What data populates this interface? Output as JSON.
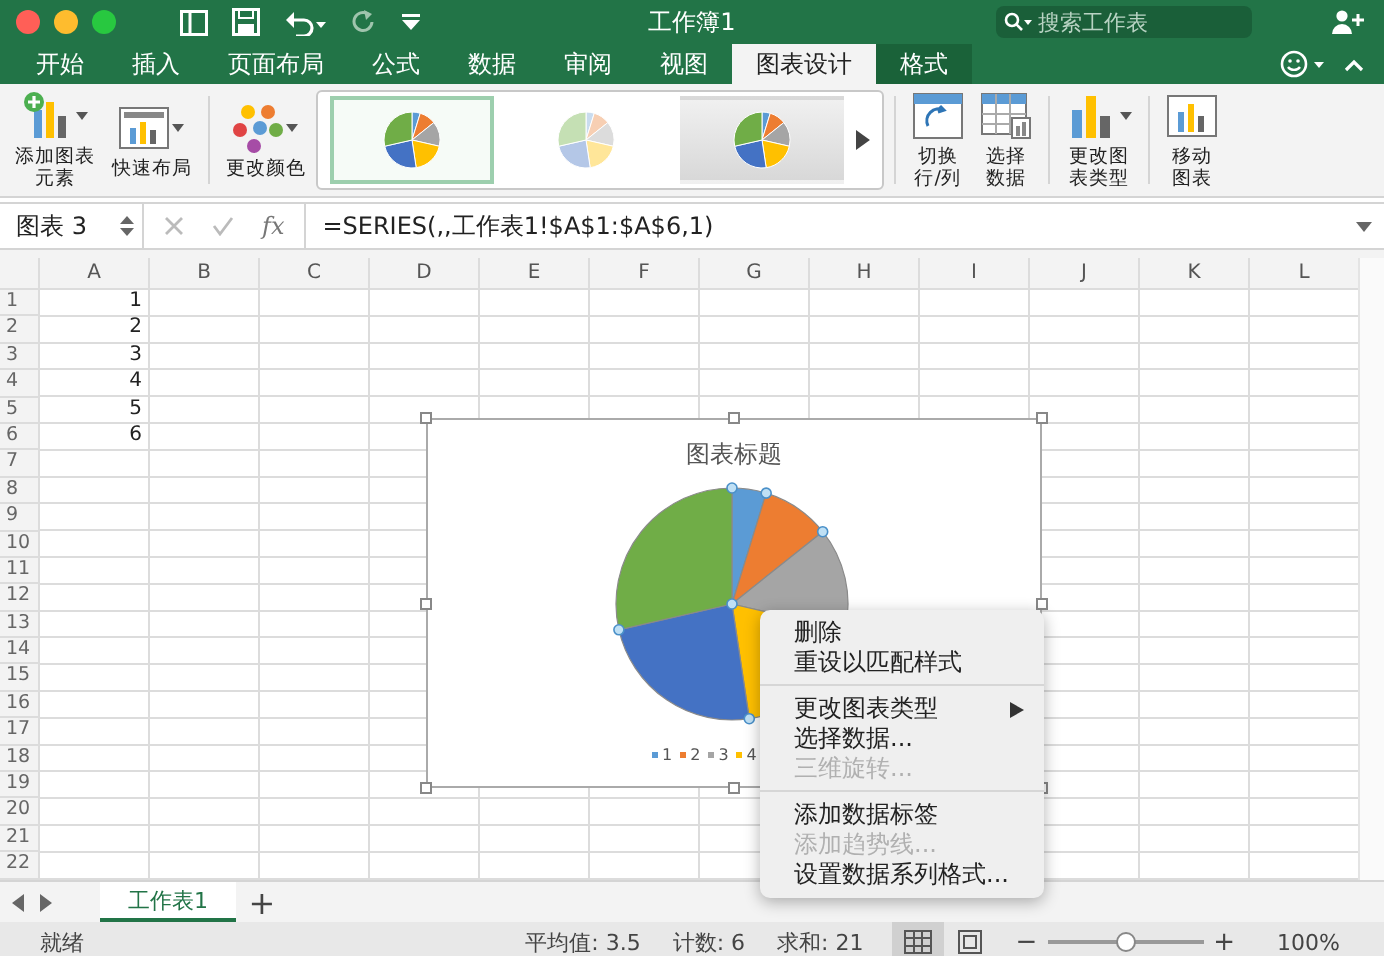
{
  "window": {
    "title": "工作簿1"
  },
  "search": {
    "placeholder": "搜索工作表"
  },
  "tabs": [
    {
      "label": "开始",
      "selected": false,
      "kind": "normal"
    },
    {
      "label": "插入",
      "selected": false,
      "kind": "normal"
    },
    {
      "label": "页面布局",
      "selected": false,
      "kind": "normal"
    },
    {
      "label": "公式",
      "selected": false,
      "kind": "normal"
    },
    {
      "label": "数据",
      "selected": false,
      "kind": "normal"
    },
    {
      "label": "审阅",
      "selected": false,
      "kind": "normal"
    },
    {
      "label": "视图",
      "selected": false,
      "kind": "normal"
    },
    {
      "label": "图表设计",
      "selected": true,
      "kind": "contextual"
    },
    {
      "label": "格式",
      "selected": false,
      "kind": "contextual"
    }
  ],
  "ribbon": {
    "left": [
      {
        "label": "添加图表元素",
        "kind": "add-element",
        "caret": true
      },
      {
        "label": "快速布局",
        "kind": "quick-layout",
        "caret": true
      },
      {
        "label": "更改颜色",
        "kind": "colors",
        "caret": true
      }
    ],
    "gallery": [
      {
        "kind": "colorful",
        "selected": true
      },
      {
        "kind": "pastel",
        "selected": false
      },
      {
        "kind": "shaded",
        "selected": false
      }
    ],
    "right": [
      {
        "label": "切换行/列",
        "kind": "switch",
        "caret": false
      },
      {
        "label": "选择数据",
        "kind": "select-data",
        "caret": false
      },
      {
        "label": "更改图表类型",
        "kind": "change-type",
        "caret": true
      },
      {
        "label": "移动图表",
        "kind": "move",
        "caret": false
      }
    ]
  },
  "formula_bar": {
    "name_box": "图表 3",
    "fx": "fx",
    "formula": "=SERIES(,,工作表1!$A$1:$A$6,1)"
  },
  "columns": [
    "A",
    "B",
    "C",
    "D",
    "E",
    "F",
    "G",
    "H",
    "I",
    "J",
    "K",
    "L"
  ],
  "rows": [
    {
      "label": "1",
      "values": [
        "1"
      ]
    },
    {
      "label": "2",
      "values": [
        "2"
      ]
    },
    {
      "label": "3",
      "values": [
        "3"
      ]
    },
    {
      "label": "4",
      "values": [
        "4"
      ]
    },
    {
      "label": "5",
      "values": [
        "5"
      ]
    },
    {
      "label": "6",
      "values": [
        "6"
      ]
    },
    {
      "label": "7"
    },
    {
      "label": "8"
    },
    {
      "label": "9"
    },
    {
      "label": "10"
    },
    {
      "label": "11"
    },
    {
      "label": "12"
    },
    {
      "label": "13"
    },
    {
      "label": "14"
    },
    {
      "label": "15"
    },
    {
      "label": "16"
    },
    {
      "label": "17"
    },
    {
      "label": "18"
    },
    {
      "label": "19"
    },
    {
      "label": "20"
    },
    {
      "label": "21"
    },
    {
      "label": "22"
    }
  ],
  "chart": {
    "title": "图表标题",
    "legend": [
      "1",
      "2",
      "3",
      "4"
    ]
  },
  "context_menu": {
    "groups": [
      [
        {
          "label": "删除",
          "disabled": false,
          "submenu": false
        },
        {
          "label": "重设以匹配样式",
          "disabled": false,
          "submenu": false
        }
      ],
      [
        {
          "label": "更改图表类型",
          "disabled": false,
          "submenu": true
        },
        {
          "label": "选择数据...",
          "disabled": false,
          "submenu": false
        },
        {
          "label": "三维旋转...",
          "disabled": true,
          "submenu": false
        }
      ],
      [
        {
          "label": "添加数据标签",
          "disabled": false,
          "submenu": false
        },
        {
          "label": "添加趋势线...",
          "disabled": true,
          "submenu": false
        },
        {
          "label": "设置数据系列格式...",
          "disabled": false,
          "submenu": false
        }
      ]
    ]
  },
  "sheet_tabs": [
    {
      "label": "工作表1",
      "selected": true
    }
  ],
  "add_sheet": "+",
  "status_bar": {
    "ready": "就绪",
    "stats": [
      "平均值: 3.5",
      "计数: 6",
      "求和: 21"
    ],
    "views": [
      {
        "kind": "normal",
        "selected": true
      },
      {
        "kind": "page-layout",
        "selected": false
      }
    ],
    "zoom": {
      "minus": "−",
      "plus": "+",
      "level": 0.5,
      "reading": "100%"
    }
  }
}
